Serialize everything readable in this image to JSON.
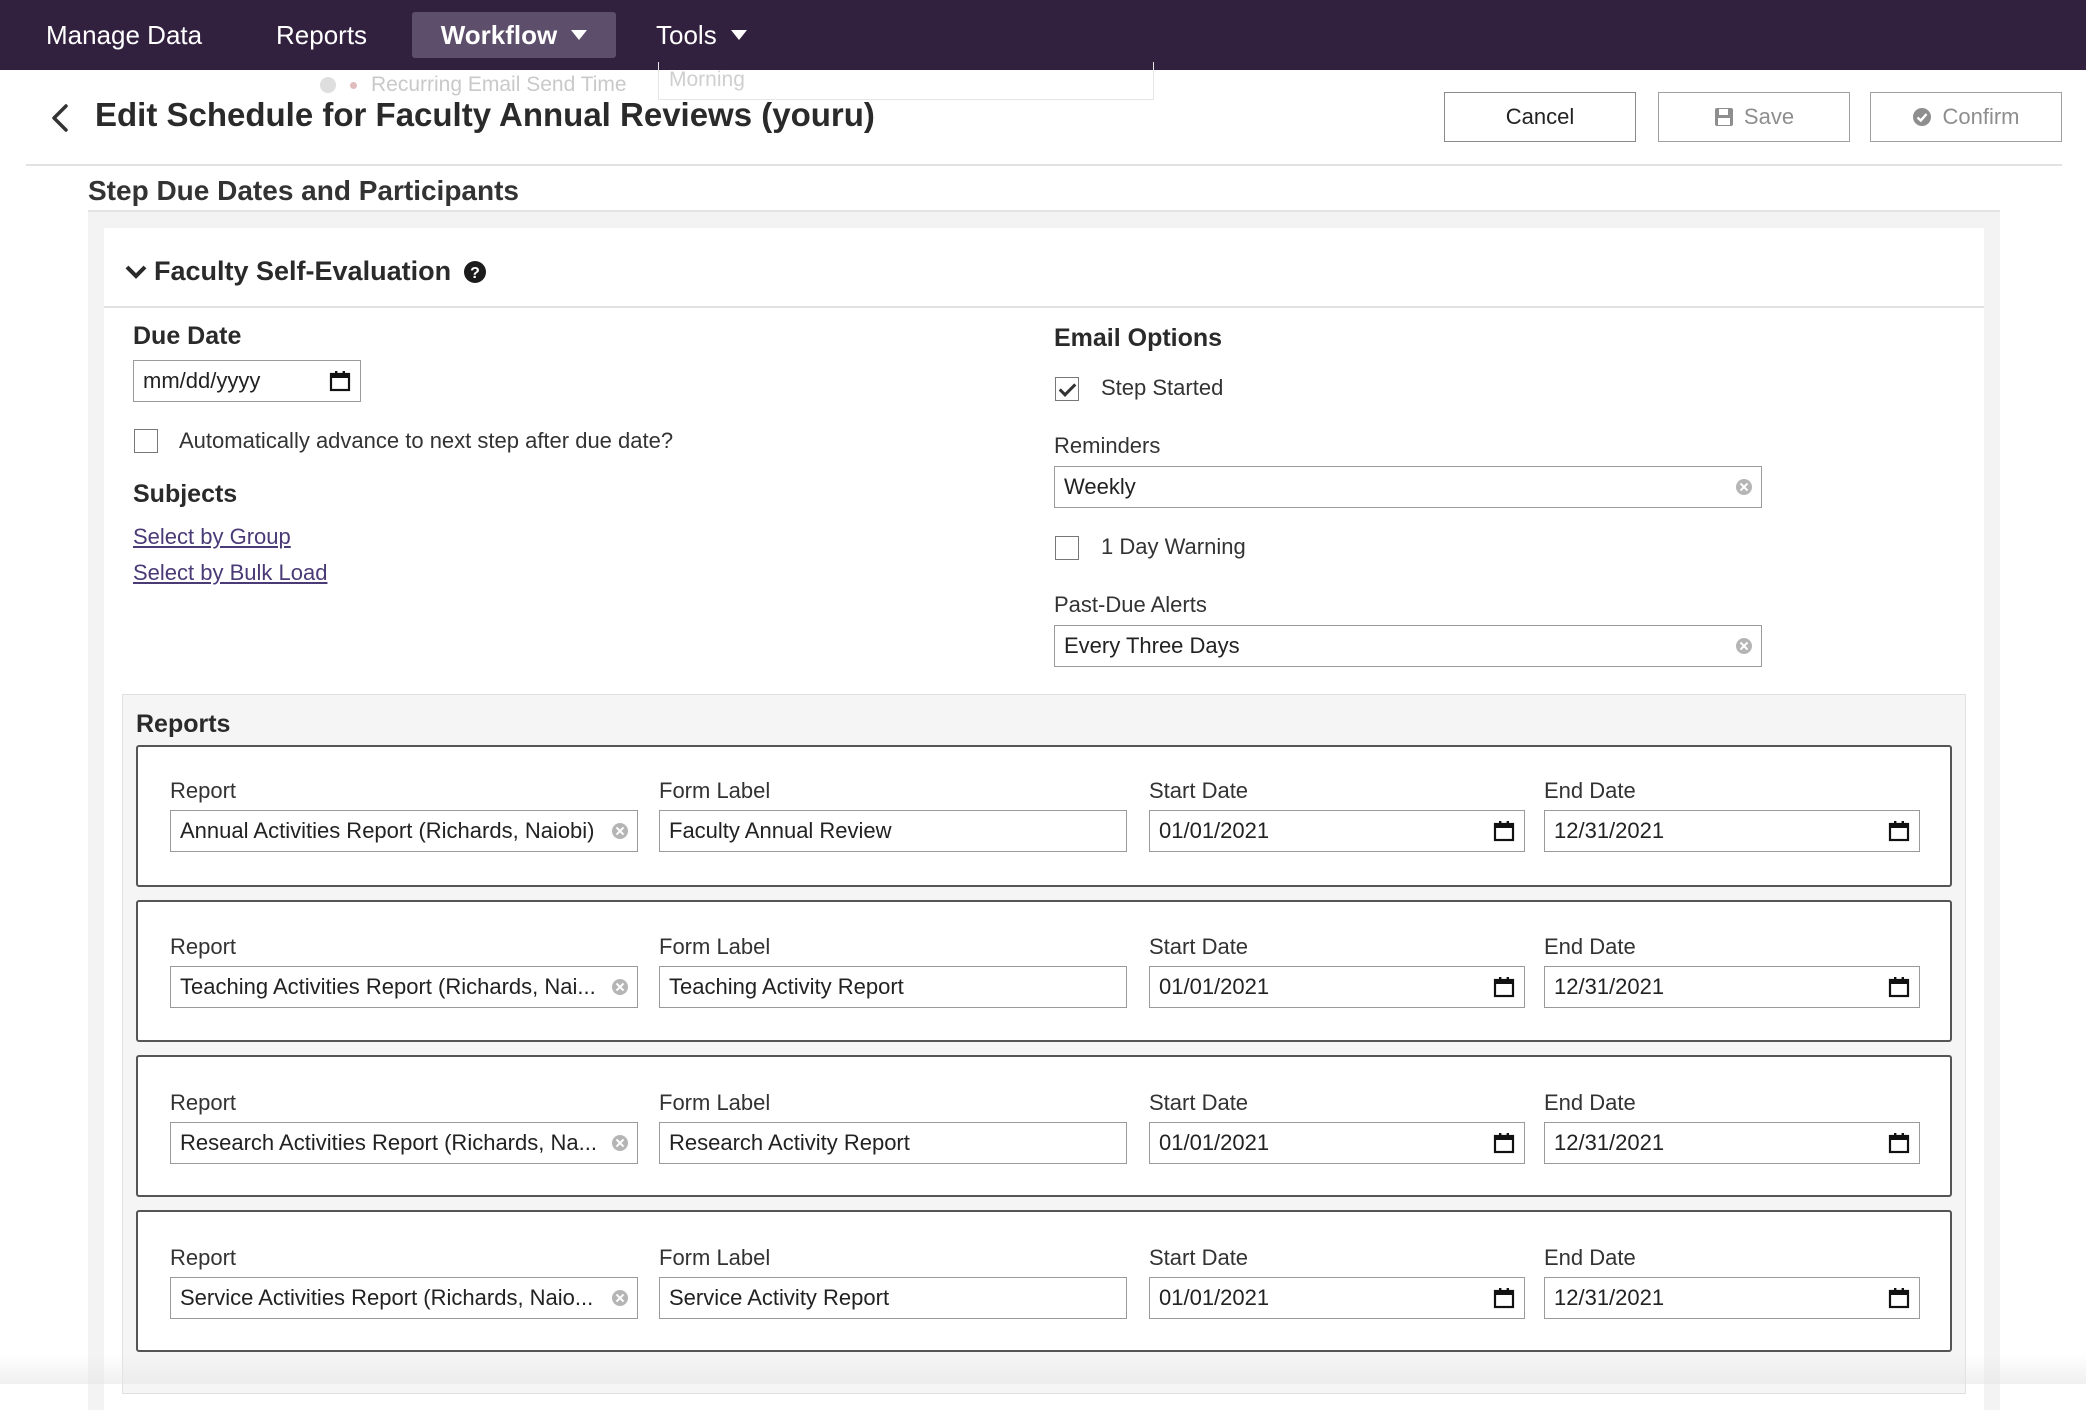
{
  "nav": {
    "items": [
      {
        "label": "Manage Data",
        "active": false,
        "caret": false
      },
      {
        "label": "Reports",
        "active": false,
        "caret": false
      },
      {
        "label": "Workflow",
        "active": true,
        "caret": true
      },
      {
        "label": "Tools",
        "active": false,
        "caret": true
      }
    ]
  },
  "ghost": {
    "label": "Recurring Email Send Time",
    "value": "Morning"
  },
  "header": {
    "title": "Edit Schedule for Faculty Annual Reviews (youru)",
    "cancel_label": "Cancel",
    "save_label": "Save",
    "confirm_label": "Confirm"
  },
  "section": {
    "title": "Step Due Dates and Participants"
  },
  "step": {
    "name": "Faculty Self-Evaluation",
    "due_date": {
      "label": "Due Date",
      "placeholder": "mm/dd/yyyy"
    },
    "auto_advance": {
      "label": "Automatically advance to next step after due date?",
      "checked": false
    },
    "subjects": {
      "label": "Subjects",
      "links": [
        "Select by Group",
        "Select by Bulk Load"
      ]
    },
    "email_options": {
      "label": "Email Options",
      "step_started": {
        "label": "Step Started",
        "checked": true
      },
      "reminders": {
        "label": "Reminders",
        "value": "Weekly"
      },
      "one_day_warning": {
        "label": "1 Day Warning",
        "checked": false
      },
      "past_due_alerts": {
        "label": "Past-Due Alerts",
        "value": "Every Three Days"
      }
    }
  },
  "reports": {
    "title": "Reports",
    "column_labels": {
      "report": "Report",
      "form_label": "Form Label",
      "start_date": "Start Date",
      "end_date": "End Date"
    },
    "rows": [
      {
        "report": "Annual Activities Report (Richards, Naiobi)",
        "form_label": "Faculty Annual Review",
        "start_date": "01/01/2021",
        "end_date": "12/31/2021"
      },
      {
        "report": "Teaching Activities Report (Richards, Nai...",
        "form_label": "Teaching Activity Report",
        "start_date": "01/01/2021",
        "end_date": "12/31/2021"
      },
      {
        "report": "Research Activities Report (Richards, Na...",
        "form_label": "Research Activity Report",
        "start_date": "01/01/2021",
        "end_date": "12/31/2021"
      },
      {
        "report": "Service Activities Report (Richards, Naio...",
        "form_label": "Service Activity Report",
        "start_date": "01/01/2021",
        "end_date": "12/31/2021"
      }
    ]
  },
  "colors": {
    "nav_bg": "#32203f",
    "nav_active": "#5d4f6b",
    "link": "#4a3a76"
  }
}
